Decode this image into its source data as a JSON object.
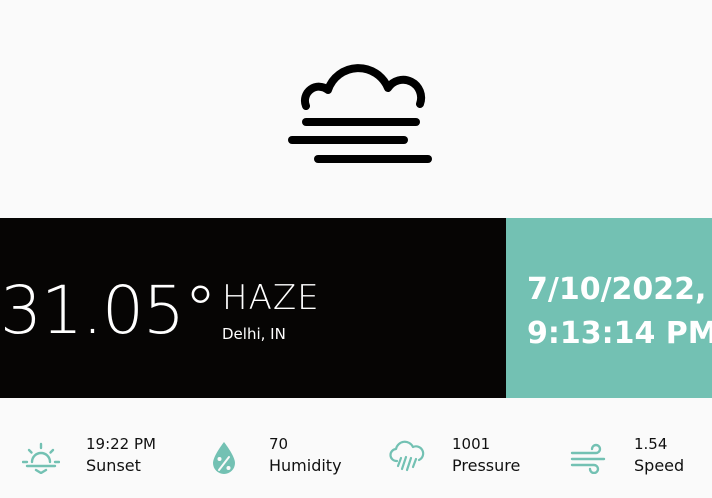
{
  "weather": {
    "temperature": "31.05°",
    "condition": "HAZE",
    "location": "Delhi, IN"
  },
  "datetime": {
    "date": "7/10/2022,",
    "time": "9:13:14 PM"
  },
  "stats": [
    {
      "value": "19:22 PM",
      "label": "Sunset",
      "icon": "sunset-icon"
    },
    {
      "value": "70",
      "label": "Humidity",
      "icon": "humidity-icon"
    },
    {
      "value": "1001",
      "label": "Pressure",
      "icon": "pressure-icon"
    },
    {
      "value": "1.54",
      "label": "Speed",
      "icon": "wind-icon"
    }
  ],
  "colors": {
    "accent": "#73c1b3",
    "band_dark": "#060504",
    "background": "#fafafa"
  }
}
